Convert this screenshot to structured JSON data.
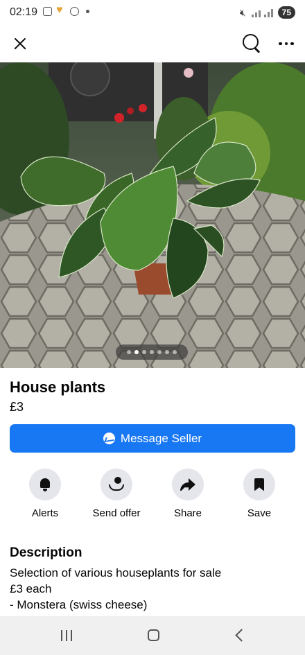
{
  "status_bar": {
    "time": "02:19",
    "battery": "75"
  },
  "listing": {
    "title": "House plants",
    "price": "£3",
    "photo_count": 7,
    "active_photo": 1
  },
  "primary_action": {
    "label": "Message Seller"
  },
  "actions": [
    {
      "label": "Alerts",
      "icon": "bell-icon"
    },
    {
      "label": "Send offer",
      "icon": "send-offer-icon"
    },
    {
      "label": "Share",
      "icon": "share-icon"
    },
    {
      "label": "Save",
      "icon": "bookmark-icon"
    }
  ],
  "description": {
    "heading": "Description",
    "lines": [
      "Selection of various houseplants for sale",
      "£3 each",
      "- Monstera (swiss cheese)"
    ]
  },
  "colors": {
    "accent": "#1877f2",
    "icon_bg": "#e4e6eb"
  }
}
